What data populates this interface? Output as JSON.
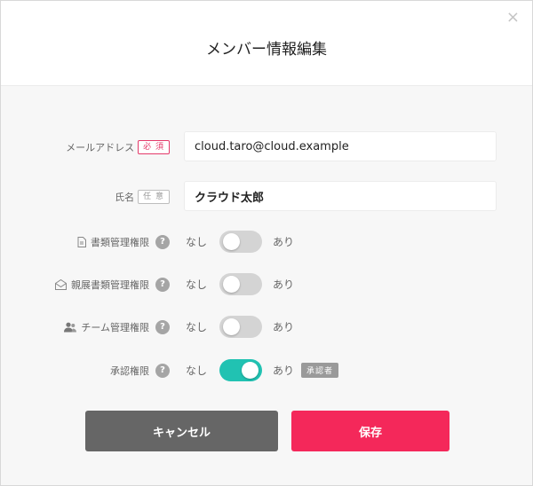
{
  "modal": {
    "title": "メンバー情報編集",
    "close_glyph": "×"
  },
  "form": {
    "email": {
      "label": "メールアドレス",
      "tag": "必 須",
      "value": "cloud.taro@cloud.example"
    },
    "name": {
      "label": "氏名",
      "tag": "任 意",
      "value": "クラウド太郎"
    },
    "permissions": [
      {
        "label": "書類管理権限",
        "icon": "document-icon",
        "help": "?",
        "off_label": "なし",
        "on_label": "あり",
        "enabled": false
      },
      {
        "label": "親展書類管理権限",
        "icon": "envelope-icon",
        "help": "?",
        "off_label": "なし",
        "on_label": "あり",
        "enabled": false
      },
      {
        "label": "チーム管理権限",
        "icon": "team-icon",
        "help": "?",
        "off_label": "なし",
        "on_label": "あり",
        "enabled": false
      },
      {
        "label": "承認権限",
        "icon": "",
        "help": "?",
        "off_label": "なし",
        "on_label": "あり",
        "enabled": true,
        "badge": "承認者"
      }
    ]
  },
  "actions": {
    "cancel_label": "キャンセル",
    "save_label": "保存"
  },
  "colors": {
    "accent": "#f4285a",
    "toggle_on": "#21c2b2",
    "cancel": "#666666"
  }
}
